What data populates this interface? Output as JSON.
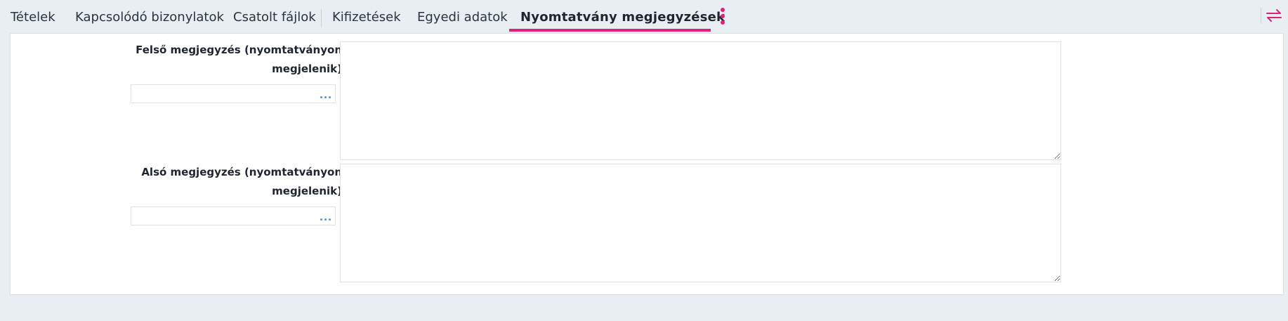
{
  "tabs": [
    {
      "label": "Tételek"
    },
    {
      "label": "Kapcsolódó bizonylatok"
    },
    {
      "label": "Csatolt fájlok"
    },
    {
      "label": "Kifizetések"
    },
    {
      "label": "Egyedi adatok"
    },
    {
      "label": "Nyomtatvány megjegyzések",
      "active": true
    }
  ],
  "accent_color": "#e0207a",
  "icons": {
    "more": "vertical-dots-icon",
    "toggle": "swap-arrows-icon",
    "lookup": "ellipsis-icon"
  },
  "fields": {
    "upper_note": {
      "label_line1": "Felső megjegyzés (nyomtatványon",
      "label_line2": "megjelenik)",
      "value": ""
    },
    "lower_note": {
      "label_line1": "Alsó megjegyzés (nyomtatványon",
      "label_line2": "megjelenik)",
      "value": ""
    }
  }
}
